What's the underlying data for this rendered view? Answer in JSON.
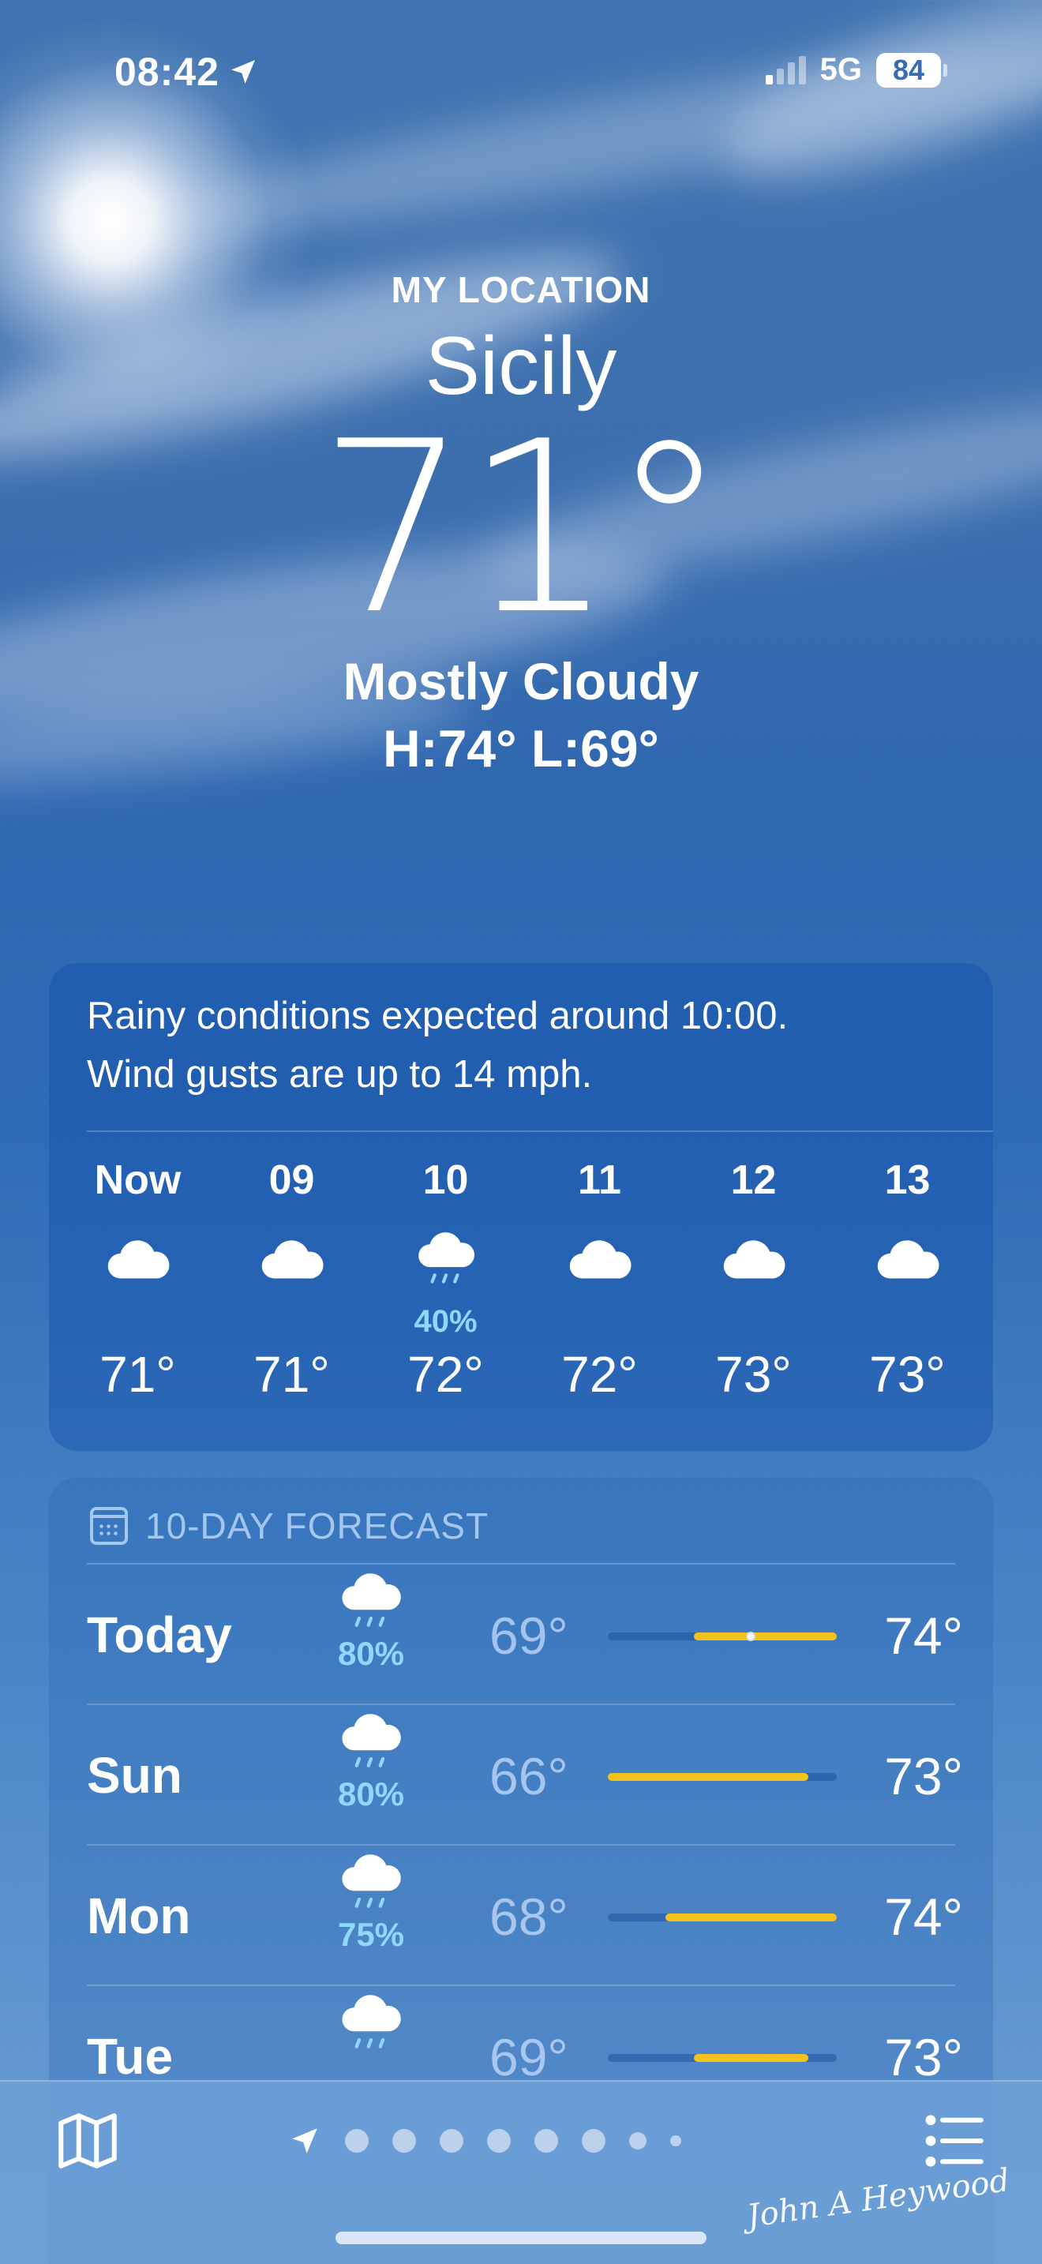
{
  "status_bar": {
    "time": "08:42",
    "network": "5G",
    "battery": "84"
  },
  "location": {
    "label": "MY LOCATION",
    "city": "Sicily",
    "temperature": "71°",
    "condition": "Mostly Cloudy",
    "high_low": "H:74°  L:69°"
  },
  "hourly": {
    "summary_line1": "Rainy conditions expected around 10:00.",
    "summary_line2": "Wind gusts are up to 14 mph.",
    "items": [
      {
        "time": "Now",
        "icon": "cloud-icon",
        "precip": "",
        "temp": "71°"
      },
      {
        "time": "09",
        "icon": "cloud-icon",
        "precip": "",
        "temp": "71°"
      },
      {
        "time": "10",
        "icon": "cloud-rain-icon",
        "precip": "40%",
        "temp": "72°"
      },
      {
        "time": "11",
        "icon": "cloud-icon",
        "precip": "",
        "temp": "72°"
      },
      {
        "time": "12",
        "icon": "cloud-icon",
        "precip": "",
        "temp": "73°"
      },
      {
        "time": "13",
        "icon": "cloud-icon",
        "precip": "",
        "temp": "73°"
      }
    ]
  },
  "daily": {
    "title": "10-DAY FORECAST",
    "range_min": 66,
    "range_max": 74,
    "current_temp": 71,
    "days": [
      {
        "day": "Today",
        "icon": "cloud-rain-icon",
        "precip": "80%",
        "low": "69°",
        "high": "74°",
        "low_value": 69,
        "high_value": 74
      },
      {
        "day": "Sun",
        "icon": "cloud-rain-icon",
        "precip": "80%",
        "low": "66°",
        "high": "73°",
        "low_value": 66,
        "high_value": 73
      },
      {
        "day": "Mon",
        "icon": "cloud-rain-icon",
        "precip": "75%",
        "low": "68°",
        "high": "74°",
        "low_value": 68,
        "high_value": 74
      },
      {
        "day": "Tue",
        "icon": "cloud-rain-icon",
        "precip": "",
        "low": "69°",
        "high": "73°",
        "low_value": 69,
        "high_value": 73
      }
    ]
  },
  "bottom_bar": {
    "page_count": 9,
    "signature": "John A Heywood"
  },
  "colors": {
    "accent_yellow": "#f4c21c",
    "precip_blue": "#8ed8ff"
  }
}
